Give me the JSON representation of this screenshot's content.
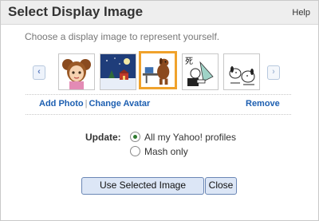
{
  "header": {
    "title": "Select Display Image",
    "help": "Help"
  },
  "subtitle": "Choose a display image to represent yourself.",
  "carousel": {
    "prev_icon": "‹",
    "next_icon": "›",
    "thumbnails": [
      {
        "name": "girl-avatar",
        "selected": false
      },
      {
        "name": "winter-night-scene",
        "selected": false
      },
      {
        "name": "dog-at-desk",
        "selected": true
      },
      {
        "name": "cartoon-reading",
        "selected": false
      },
      {
        "name": "cartoon-dog-figures",
        "selected": false
      }
    ]
  },
  "actions": {
    "add_photo": "Add Photo",
    "separator": "|",
    "change_avatar": "Change Avatar",
    "remove": "Remove"
  },
  "update": {
    "label": "Update:",
    "options": [
      {
        "label": "All my Yahoo! profiles",
        "checked": true
      },
      {
        "label": "Mash only",
        "checked": false
      }
    ]
  },
  "buttons": {
    "use_selected": "Use Selected Image",
    "close": "Close"
  },
  "colors": {
    "link": "#1d5fb1",
    "selected_border": "#f0a22c",
    "button_bg": "#dce6f6"
  }
}
